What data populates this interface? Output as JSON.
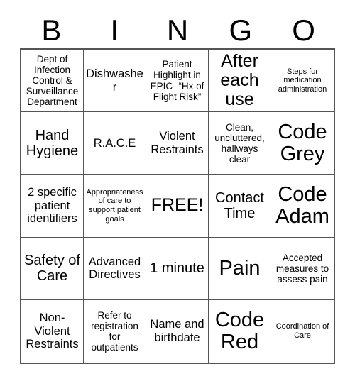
{
  "card": {
    "type": "bingo-card",
    "columns": 5,
    "rows": 5,
    "header_letters": [
      "B",
      "I",
      "N",
      "G",
      "O"
    ],
    "free_space": {
      "row": 3,
      "column": 3,
      "label": "FREE!"
    },
    "colors": {
      "background": "#ffffff",
      "text": "#000000",
      "grid_line": "#555555"
    },
    "cells": [
      {
        "row": 1,
        "col": 1,
        "text": "Dept of Infection Control & Surveillance Department",
        "size": "fs-sm"
      },
      {
        "row": 1,
        "col": 2,
        "text": "Dishwasher",
        "size": "fs-md"
      },
      {
        "row": 1,
        "col": 3,
        "text": "Patient Highlight in EPIC- “Hx of Flight Risk”",
        "size": "fs-sm"
      },
      {
        "row": 1,
        "col": 4,
        "text": "After each use",
        "size": "fs-xl"
      },
      {
        "row": 1,
        "col": 5,
        "text": "Steps for medication administration",
        "size": "fs-xs"
      },
      {
        "row": 2,
        "col": 1,
        "text": "Hand Hygiene",
        "size": "fs-lg"
      },
      {
        "row": 2,
        "col": 2,
        "text": "R.A.C.E",
        "size": "fs-md"
      },
      {
        "row": 2,
        "col": 3,
        "text": "Violent Restraints",
        "size": "fs-md"
      },
      {
        "row": 2,
        "col": 4,
        "text": "Clean, uncluttered, hallways clear",
        "size": "fs-sm"
      },
      {
        "row": 2,
        "col": 5,
        "text": "Code Grey",
        "size": "fs-xxl"
      },
      {
        "row": 3,
        "col": 1,
        "text": "2 specific patient identifiers",
        "size": "fs-md"
      },
      {
        "row": 3,
        "col": 2,
        "text": "Appropriateness of care to support patient goals",
        "size": "fs-xs"
      },
      {
        "row": 3,
        "col": 3,
        "text": "FREE!",
        "size": "fs-xl"
      },
      {
        "row": 3,
        "col": 4,
        "text": "Contact Time",
        "size": "fs-lg"
      },
      {
        "row": 3,
        "col": 5,
        "text": "Code Adam",
        "size": "fs-xxl"
      },
      {
        "row": 4,
        "col": 1,
        "text": "Safety of Care",
        "size": "fs-lg"
      },
      {
        "row": 4,
        "col": 2,
        "text": "Advanced Directives",
        "size": "fs-md"
      },
      {
        "row": 4,
        "col": 3,
        "text": "1 minute",
        "size": "fs-lg"
      },
      {
        "row": 4,
        "col": 4,
        "text": "Pain",
        "size": "fs-xxl"
      },
      {
        "row": 4,
        "col": 5,
        "text": "Accepted measures to assess pain",
        "size": "fs-sm"
      },
      {
        "row": 5,
        "col": 1,
        "text": "Non-Violent Restraints",
        "size": "fs-md"
      },
      {
        "row": 5,
        "col": 2,
        "text": "Refer to registration for outpatients",
        "size": "fs-sm"
      },
      {
        "row": 5,
        "col": 3,
        "text": "Name and birthdate",
        "size": "fs-md"
      },
      {
        "row": 5,
        "col": 4,
        "text": "Code Red",
        "size": "fs-xxl"
      },
      {
        "row": 5,
        "col": 5,
        "text": "Coordination of Care",
        "size": "fs-xs"
      }
    ]
  }
}
